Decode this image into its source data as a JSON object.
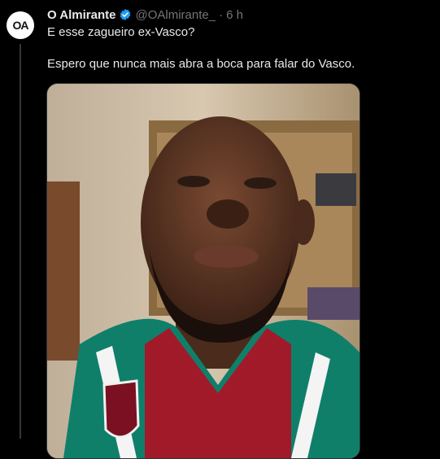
{
  "tweet": {
    "author_name": "O Almirante",
    "author_handle": "@OAlmirante_",
    "separator": "·",
    "time": "6 h",
    "avatar_text": "OA",
    "line1": "E  esse zagueiro ex-Vasco?",
    "line2": "Espero que nunca mais abra a boca para falar do Vasco."
  },
  "icons": {
    "verified": "verified-badge-icon"
  },
  "colors": {
    "verified": "#1d9bf0",
    "muted": "#71767b",
    "text": "#e7e9ea",
    "background": "#000000"
  }
}
